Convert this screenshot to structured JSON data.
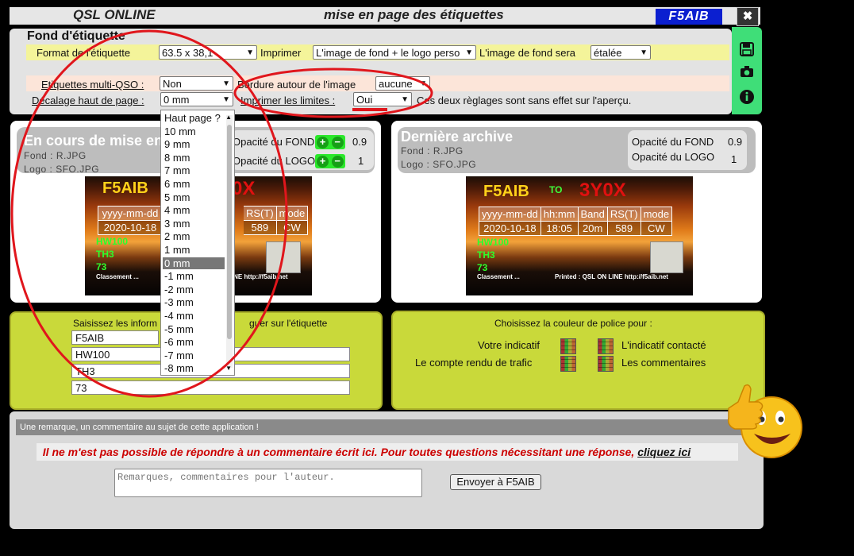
{
  "header": {
    "app_title": "QSL ONLINE",
    "page_title": "mise en page des étiquettes",
    "logo": "F5AIB",
    "close_icon": "close-icon"
  },
  "settings": {
    "section_title": "Fond d'étiquette",
    "format_label": "Format de l'étiquette",
    "format_value": "63.5 x 38,1",
    "imprimer_label": "Imprimer",
    "imprimer_value": "L'image de fond + le logo perso",
    "fond_sera_label": "L'image de fond sera",
    "fond_sera_value": "étalée",
    "multi_label": "Etiquettes multi-QSO :",
    "multi_value": "Non",
    "bordure_label": "Bordure autour de l'image",
    "bordure_value": "aucune",
    "decalage_label": "Décalage haut de page :",
    "decalage_value": "0 mm",
    "limites_label": "Imprimer les limites :",
    "limites_value": "Oui",
    "note": "Ces deux règlages sont sans effet sur l'aperçu."
  },
  "rail_icons": [
    "save-icon",
    "camera-icon",
    "info-icon"
  ],
  "dropdown": {
    "options": [
      "Haut page ?",
      "10 mm",
      "9 mm",
      "8 mm",
      "7 mm",
      "6 mm",
      "5 mm",
      "4 mm",
      "3 mm",
      "2 mm",
      "1 mm",
      "0 mm",
      "-1 mm",
      "-2 mm",
      "-3 mm",
      "-4 mm",
      "-5 mm",
      "-6 mm",
      "-7 mm",
      "-8 mm"
    ],
    "selected": "0 mm"
  },
  "current": {
    "title": "En cours de mise en",
    "fond": "Fond : R.JPG",
    "logo": "Logo : SFO.JPG",
    "opacite_fond": "Opacité du FOND",
    "opacite_fond_val": "0.9",
    "opacite_logo": "Opacité du LOGO",
    "opacite_logo_val": "1",
    "qsl": {
      "call": "F5AIB",
      "dest": "0X",
      "h1": "yyyy-mm-dd",
      "h2": "RS(T)",
      "h3": "mode",
      "d1": "2020-10-18",
      "d2": "589",
      "d3": "CW",
      "l1": "HW100",
      "l2": "TH3",
      "l3": "73",
      "foot": "Classement ...",
      "foot2": "LINE http://f5aib.net"
    }
  },
  "archive": {
    "title": "Dernière archive",
    "fond": "Fond : R.JPG",
    "logo": "Logo : SFO.JPG",
    "opacite_fond": "Opacité du FOND",
    "opacite_fond_val": "0.9",
    "opacite_logo": "Opacité du LOGO",
    "opacite_logo_val": "1",
    "qsl": {
      "call": "F5AIB",
      "to": "TO",
      "dest": "3Y0X",
      "h": [
        "yyyy-mm-dd",
        "hh:mm",
        "Band",
        "RS(T)",
        "mode"
      ],
      "d": [
        "2020-10-18",
        "18:05",
        "20m",
        "589",
        "CW"
      ],
      "l1": "HW100",
      "l2": "TH3",
      "l3": "73",
      "foot": "Classement ...",
      "foot2": "Printed : QSL ON LINE http://f5aib.net"
    }
  },
  "input_panel": {
    "title": "Saisissez les inform",
    "title2": "guer sur l'étiquette",
    "values": [
      "F5AIB",
      "HW100",
      "TH3",
      "73"
    ]
  },
  "color_panel": {
    "title": "Choisissez la couleur de police pour :",
    "votre": "Votre indicatif",
    "contacte": "L'indicatif contacté",
    "compte": "Le compte rendu de trafic",
    "commentaires": "Les commentaires"
  },
  "comment": {
    "bar": "Une remarque, un commentaire au sujet de cette application !",
    "warning": "Il ne m'est pas possible de répondre à un commentaire écrit ici. Pour toutes questions nécessitant une réponse,",
    "link": "cliquez ici",
    "placeholder": "Remarques, commentaires pour l'auteur.",
    "send": "Envoyer à F5AIB"
  },
  "colors": {
    "lime": "#c9d93a",
    "rail": "#3fde78",
    "logo_bg": "#0b1fd0",
    "annotation": "#e0161c"
  }
}
